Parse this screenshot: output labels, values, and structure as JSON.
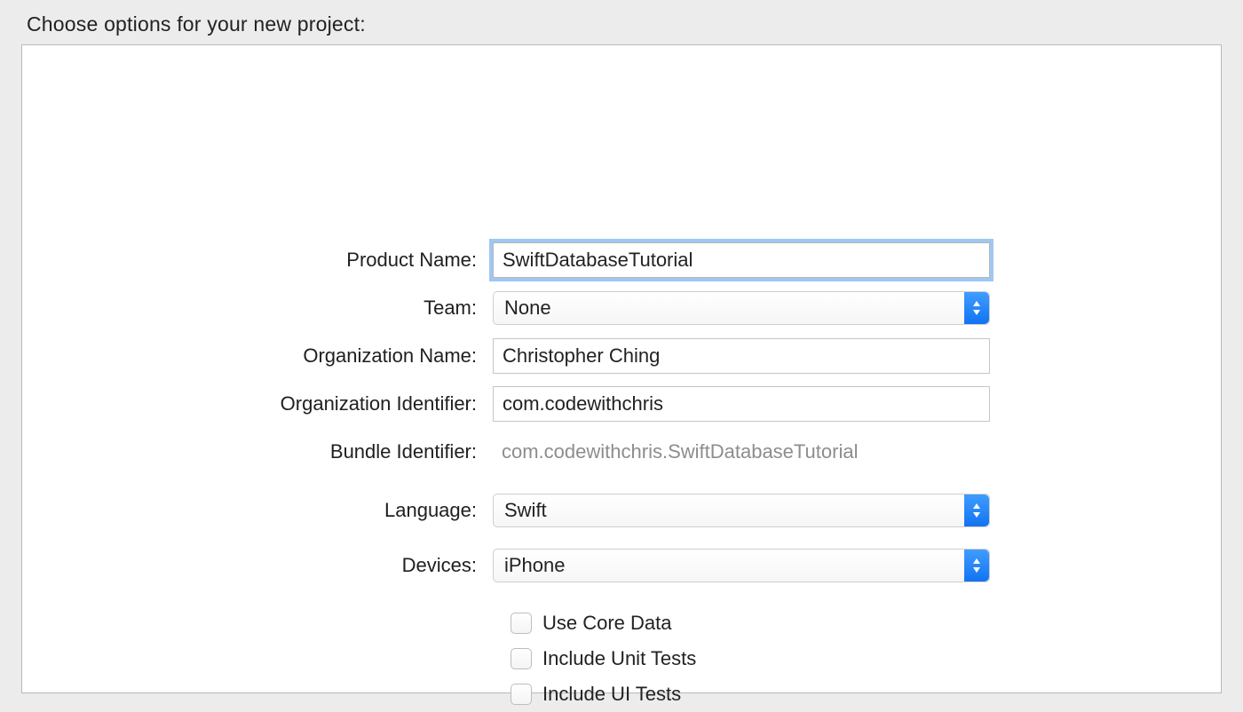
{
  "heading": "Choose options for your new project:",
  "labels": {
    "productName": "Product Name:",
    "team": "Team:",
    "orgName": "Organization Name:",
    "orgId": "Organization Identifier:",
    "bundleId": "Bundle Identifier:",
    "language": "Language:",
    "devices": "Devices:"
  },
  "values": {
    "productName": "SwiftDatabaseTutorial",
    "team": "None",
    "orgName": "Christopher Ching",
    "orgId": "com.codewithchris",
    "bundleId": "com.codewithchris.SwiftDatabaseTutorial",
    "language": "Swift",
    "devices": "iPhone"
  },
  "checkboxes": {
    "coreData": "Use Core Data",
    "unitTests": "Include Unit Tests",
    "uiTests": "Include UI Tests"
  }
}
